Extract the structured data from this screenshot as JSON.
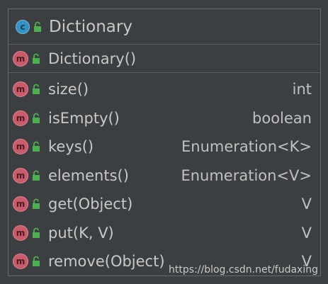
{
  "class": {
    "icon_letter": "c",
    "name": "Dictionary"
  },
  "constructor": {
    "icon_letter": "m",
    "name": "Dictionary()"
  },
  "methods": [
    {
      "icon_letter": "m",
      "name": "size()",
      "type": "int"
    },
    {
      "icon_letter": "m",
      "name": "isEmpty()",
      "type": "boolean"
    },
    {
      "icon_letter": "m",
      "name": "keys()",
      "type": "Enumeration<K>"
    },
    {
      "icon_letter": "m",
      "name": "elements()",
      "type": "Enumeration<V>"
    },
    {
      "icon_letter": "m",
      "name": "get(Object)",
      "type": "V"
    },
    {
      "icon_letter": "m",
      "name": "put(K, V)",
      "type": "V"
    },
    {
      "icon_letter": "m",
      "name": "remove(Object)",
      "type": "V"
    }
  ],
  "watermark": "https://blog.csdn.net/fudaxing",
  "colors": {
    "background": "#3c3f41",
    "class_icon": "#3592c4",
    "method_icon": "#c95b6b",
    "public_lock": "#4caf50"
  },
  "icons": {
    "class": "class-icon",
    "method": "method-icon",
    "visibility": "public-lock-icon"
  }
}
